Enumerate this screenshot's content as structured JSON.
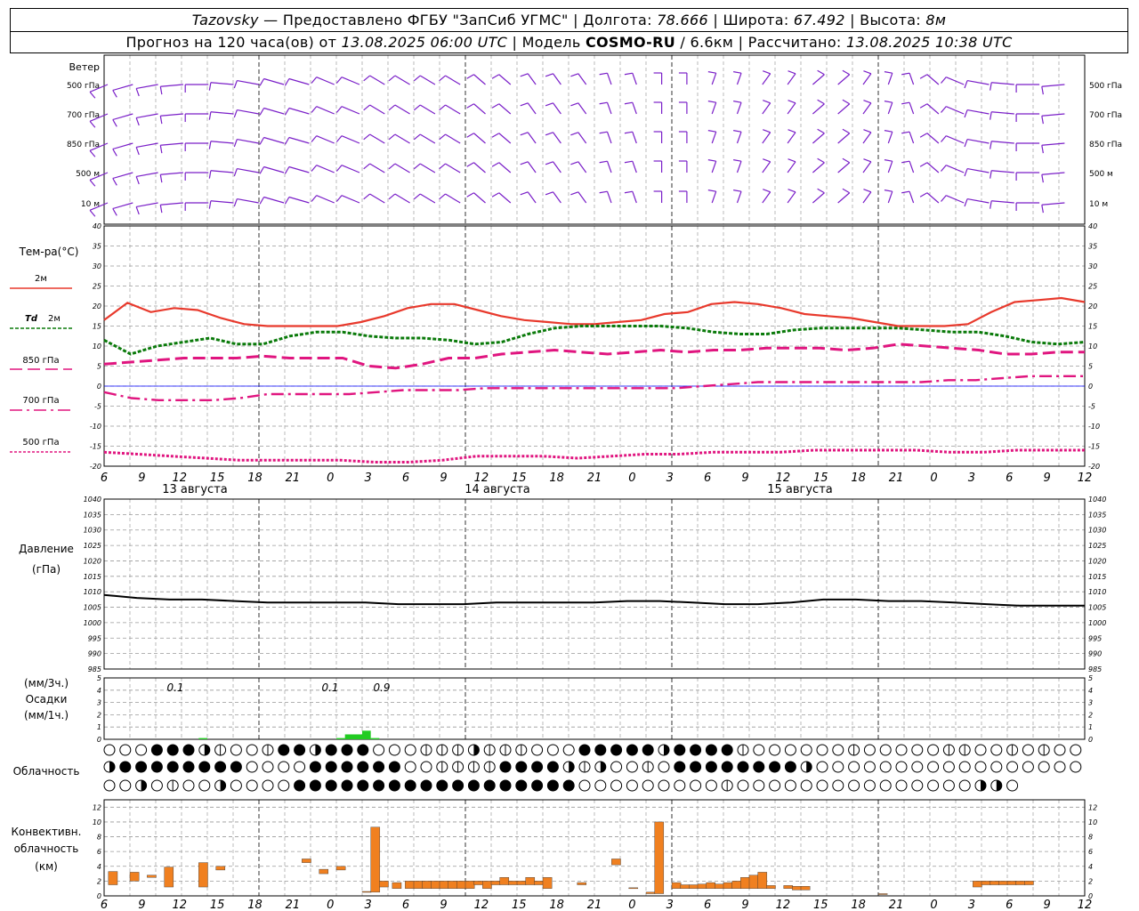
{
  "header": {
    "station": "Tazovsky",
    "provider": "— Предоставлено ФГБУ \"ЗапСиб УГМС\"",
    "lon_label": "| Долгота:",
    "lon": "78.666",
    "lat_label": "| Широта:",
    "lat": "67.492",
    "alt_label": "| Высота:",
    "alt": "8м",
    "fc_label": "Прогноз на 120 часа(ов) от",
    "fc_from": "13.08.2025 06:00 UTC",
    "model_label": "| Модель",
    "model": "COSMO-RU",
    "model_res": "/ 6.6км",
    "calc_label": "| Рассчитано:",
    "calc": "13.08.2025 10:38 UTC"
  },
  "labels": {
    "wind": "Ветер",
    "wind_levels": [
      "500 гПа",
      "700 гПа",
      "850 гПа",
      "500 м",
      "10 м"
    ],
    "temp": "Тем-ра(°C)",
    "t2m": "2м",
    "td_a": "Td",
    "td_b": "2м",
    "t850": "850 гПа",
    "t700": "700 гПа",
    "t500": "500 гПа",
    "pressure_a": "Давление",
    "pressure_b": "(гПа)",
    "precip_a": "(мм/3ч.)",
    "precip_b": "Осадки",
    "precip_c": "(мм/1ч.)",
    "cloud": "Облачность",
    "conv_a": "Конвективн.",
    "conv_b": "облачность",
    "conv_c": "(км)",
    "dates": [
      "13 августа",
      "14 августа",
      "15 августа"
    ]
  },
  "colors": {
    "wind": "#7a1fc8",
    "t2m": "#e8392c",
    "td": "#0a7a0a",
    "t850": "#e0157f",
    "t700": "#e0157f",
    "t500": "#e0157f",
    "precip": "#22cc22",
    "conv": "#f08020",
    "pressure": "#000000",
    "zero_line": "#0000ff"
  },
  "chart_data": [
    {
      "type": "line",
      "title": "Тем-ра(°C)",
      "x_hours": [
        0,
        3,
        6,
        9,
        12,
        15,
        18,
        21,
        24,
        27,
        30,
        33,
        36,
        39,
        42,
        45,
        48,
        51,
        54,
        57,
        60,
        63,
        66,
        69,
        72,
        75,
        78,
        81,
        84,
        87,
        90,
        93,
        96,
        99,
        102,
        105,
        108,
        111,
        114,
        117,
        120
      ],
      "x_tick_labels": [
        "6",
        "9",
        "12",
        "15",
        "18",
        "21",
        "0",
        "3",
        "6",
        "9",
        "12",
        "15",
        "18",
        "21",
        "0",
        "3",
        "6",
        "9",
        "12",
        "15",
        "18",
        "21",
        "0",
        "3",
        "6",
        "9",
        "12"
      ],
      "ylim": [
        -20,
        40
      ],
      "yticks": [
        -20,
        -15,
        -10,
        -5,
        0,
        5,
        10,
        15,
        20,
        25,
        30,
        35,
        40
      ],
      "series": [
        {
          "name": "2м",
          "key": "t2m",
          "values": [
            16.5,
            20.8,
            18.5,
            19.5,
            19,
            17,
            15.5,
            15,
            15,
            15,
            15,
            16,
            17.5,
            19.5,
            20.5,
            20.5,
            19,
            17.5,
            16.5,
            16,
            15.5,
            15.5,
            16,
            16.5,
            18,
            18.5,
            20.5,
            21,
            20.5,
            19.5,
            18,
            17.5,
            17,
            16,
            15,
            15,
            15,
            15.5,
            18.5,
            21,
            21.5,
            22,
            21
          ]
        },
        {
          "name": "Td 2м",
          "key": "td",
          "values": [
            11.5,
            8,
            10,
            11,
            12,
            10.5,
            10.5,
            12.5,
            13.5,
            13.5,
            12.5,
            12,
            12,
            11.5,
            10.5,
            11,
            13,
            14.5,
            15,
            15,
            15,
            15,
            14.5,
            13.5,
            13,
            13,
            14,
            14.5,
            14.5,
            14.5,
            14.5,
            14,
            13.5,
            13.5,
            12.5,
            11,
            10.5,
            11
          ]
        },
        {
          "name": "850 гПа",
          "key": "t850",
          "values": [
            5.5,
            6,
            6.5,
            7,
            7,
            7,
            7.5,
            7,
            7,
            7,
            5,
            4.5,
            5.5,
            7,
            7,
            8,
            8.5,
            9,
            8.5,
            8,
            8.5,
            9,
            8.5,
            9,
            9,
            9.5,
            9.5,
            9.5,
            9,
            9.5,
            10.5,
            10,
            9.5,
            9,
            8,
            8,
            8.5,
            8.5
          ]
        },
        {
          "name": "700 гПа",
          "key": "t700",
          "values": [
            -1.5,
            -3,
            -3.5,
            -3.5,
            -3.5,
            -3,
            -2,
            -2,
            -2,
            -2,
            -1.5,
            -1,
            -1,
            -1,
            -0.5,
            -0.5,
            -0.5,
            -0.5,
            -0.5,
            -0.5,
            -0.5,
            -0.5,
            0,
            0.5,
            1,
            1,
            1,
            1,
            1,
            1,
            1,
            1.5,
            1.5,
            2,
            2.5,
            2.5,
            2.5
          ]
        },
        {
          "name": "500 гПа",
          "key": "t500",
          "values": [
            -16.5,
            -17,
            -17.5,
            -18,
            -18.5,
            -18.5,
            -18.5,
            -18.5,
            -19,
            -19,
            -18.5,
            -17.5,
            -17.5,
            -17.5,
            -18,
            -17.5,
            -17,
            -17,
            -16.5,
            -16.5,
            -16.5,
            -16,
            -16,
            -16,
            -16,
            -16.5,
            -16.5,
            -16,
            -16,
            -16
          ]
        }
      ]
    },
    {
      "type": "line",
      "title": "Давление",
      "ylim": [
        985,
        1040
      ],
      "yticks": [
        985,
        990,
        995,
        1000,
        1005,
        1010,
        1015,
        1020,
        1025,
        1030,
        1035,
        1040
      ],
      "series": [
        {
          "name": "Давление",
          "values": [
            1009,
            1008,
            1007.5,
            1007.5,
            1007,
            1006.5,
            1006.5,
            1006.5,
            1006.5,
            1006,
            1006,
            1006,
            1006.5,
            1006.5,
            1006.5,
            1006.5,
            1007,
            1007,
            1006.5,
            1006,
            1006,
            1006.5,
            1007.5,
            1007.5,
            1007,
            1007,
            1006.5,
            1006,
            1005.5,
            1005.5,
            1005.5
          ]
        }
      ]
    },
    {
      "type": "bar",
      "title": "Осадки",
      "ylim": [
        0,
        5
      ],
      "yticks": [
        0,
        1,
        2,
        3,
        4,
        5
      ],
      "annotations": [
        {
          "hour": 6,
          "text": "0.1"
        },
        {
          "hour": 24,
          "text": "0.1"
        },
        {
          "hour": 30,
          "text": "0.9"
        }
      ],
      "bars": [
        {
          "start": 11,
          "end": 12,
          "value": 0.1
        },
        {
          "start": 27,
          "end": 28,
          "value": 0.1
        },
        {
          "start": 28,
          "end": 30,
          "value": 0.4
        },
        {
          "start": 30,
          "end": 31,
          "value": 0.7
        },
        {
          "start": 31,
          "end": 32,
          "value": 0.1
        }
      ]
    },
    {
      "type": "bar",
      "title": "Конвективн. облачность (км)",
      "ylim": [
        0,
        13
      ],
      "yticks": [
        0,
        2,
        4,
        6,
        8,
        10,
        12
      ],
      "bars": [
        {
          "start": 0.5,
          "b": 1.5,
          "t": 3.3
        },
        {
          "start": 3,
          "b": 2.0,
          "t": 3.2
        },
        {
          "start": 5,
          "b": 2.5,
          "t": 2.8
        },
        {
          "start": 7,
          "b": 1.2,
          "t": 3.9
        },
        {
          "start": 11,
          "b": 1.2,
          "t": 4.5
        },
        {
          "start": 13,
          "b": 3.5,
          "t": 4.0
        },
        {
          "start": 23,
          "b": 4.5,
          "t": 5.0
        },
        {
          "start": 25,
          "b": 3.0,
          "t": 3.6
        },
        {
          "start": 27,
          "b": 3.5,
          "t": 4.0
        },
        {
          "start": 30,
          "b": 0.5,
          "t": 0.6
        },
        {
          "start": 31,
          "b": 0.5,
          "t": 9.3
        },
        {
          "start": 32,
          "b": 1.2,
          "t": 2.0
        },
        {
          "start": 33.5,
          "b": 1.0,
          "t": 1.8
        },
        {
          "start": 35,
          "b": 1.0,
          "t": 2.0
        },
        {
          "start": 36,
          "b": 1.0,
          "t": 2.0
        },
        {
          "start": 37,
          "b": 1.0,
          "t": 2.0
        },
        {
          "start": 38,
          "b": 1.0,
          "t": 2.0
        },
        {
          "start": 39,
          "b": 1.0,
          "t": 2.0
        },
        {
          "start": 40,
          "b": 1.0,
          "t": 2.0
        },
        {
          "start": 41,
          "b": 1.0,
          "t": 2.0
        },
        {
          "start": 42,
          "b": 1.0,
          "t": 2.0
        },
        {
          "start": 43,
          "b": 1.5,
          "t": 2.0
        },
        {
          "start": 44,
          "b": 1.0,
          "t": 2.0
        },
        {
          "start": 45,
          "b": 1.5,
          "t": 2.0
        },
        {
          "start": 46,
          "b": 1.5,
          "t": 2.5
        },
        {
          "start": 47,
          "b": 1.5,
          "t": 2.0
        },
        {
          "start": 48,
          "b": 1.5,
          "t": 2.0
        },
        {
          "start": 49,
          "b": 1.5,
          "t": 2.5
        },
        {
          "start": 50,
          "b": 1.5,
          "t": 2.0
        },
        {
          "start": 51,
          "b": 1.0,
          "t": 2.5
        },
        {
          "start": 55,
          "b": 1.5,
          "t": 1.8
        },
        {
          "start": 59,
          "b": 4.2,
          "t": 5.0
        },
        {
          "start": 61,
          "b": 1.0,
          "t": 1.1
        },
        {
          "start": 63,
          "b": 0.3,
          "t": 0.5
        },
        {
          "start": 64,
          "b": 0.3,
          "t": 10.0
        },
        {
          "start": 66,
          "b": 1.0,
          "t": 1.8
        },
        {
          "start": 67,
          "b": 1.0,
          "t": 1.5
        },
        {
          "start": 68,
          "b": 1.0,
          "t": 1.5
        },
        {
          "start": 69,
          "b": 1.0,
          "t": 1.6
        },
        {
          "start": 70,
          "b": 1.0,
          "t": 1.8
        },
        {
          "start": 71,
          "b": 1.0,
          "t": 1.6
        },
        {
          "start": 72,
          "b": 1.0,
          "t": 1.8
        },
        {
          "start": 73,
          "b": 1.0,
          "t": 2.0
        },
        {
          "start": 74,
          "b": 1.0,
          "t": 2.5
        },
        {
          "start": 75,
          "b": 1.0,
          "t": 2.8
        },
        {
          "start": 76,
          "b": 1.0,
          "t": 3.2
        },
        {
          "start": 77,
          "b": 1.0,
          "t": 1.4
        },
        {
          "start": 79,
          "b": 1.0,
          "t": 1.4
        },
        {
          "start": 80,
          "b": 0.8,
          "t": 1.3
        },
        {
          "start": 81,
          "b": 0.8,
          "t": 1.3
        },
        {
          "start": 90,
          "b": 0.2,
          "t": 0.3
        },
        {
          "start": 101,
          "b": 1.2,
          "t": 2.0
        },
        {
          "start": 102,
          "b": 1.5,
          "t": 2.0
        },
        {
          "start": 103,
          "b": 1.5,
          "t": 2.0
        },
        {
          "start": 104,
          "b": 1.5,
          "t": 2.0
        },
        {
          "start": 105,
          "b": 1.5,
          "t": 2.0
        },
        {
          "start": 106,
          "b": 1.5,
          "t": 2.0
        },
        {
          "start": 107,
          "b": 1.5,
          "t": 2.0
        }
      ]
    }
  ],
  "wind_direction_rows": [
    [
      230,
      240,
      250,
      260,
      270,
      280,
      290,
      300,
      300,
      310,
      310,
      320,
      320,
      320,
      320,
      330,
      330,
      340,
      340,
      340,
      350,
      350,
      0,
      0,
      10,
      10,
      20,
      20,
      30,
      30,
      20,
      10,
      350,
      330,
      310,
      290,
      280,
      270,
      260
    ],
    [
      230,
      240,
      250,
      260,
      270,
      280,
      290,
      300,
      300,
      310,
      310,
      320,
      320,
      320,
      320,
      330,
      330,
      340,
      340,
      340,
      350,
      350,
      0,
      0,
      10,
      10,
      20,
      20,
      30,
      30,
      20,
      10,
      350,
      330,
      310,
      290,
      280,
      270,
      260
    ],
    [
      230,
      240,
      250,
      260,
      270,
      280,
      290,
      300,
      300,
      310,
      310,
      320,
      320,
      320,
      320,
      330,
      330,
      340,
      340,
      340,
      350,
      350,
      0,
      0,
      10,
      10,
      20,
      20,
      30,
      30,
      20,
      10,
      350,
      330,
      310,
      290,
      280,
      270,
      260
    ],
    [
      230,
      240,
      250,
      260,
      270,
      280,
      290,
      300,
      300,
      310,
      310,
      320,
      320,
      320,
      320,
      330,
      330,
      340,
      340,
      340,
      350,
      350,
      0,
      0,
      10,
      10,
      20,
      20,
      30,
      30,
      20,
      10,
      350,
      330,
      310,
      290,
      280,
      270,
      260
    ],
    [
      230,
      240,
      250,
      260,
      270,
      280,
      290,
      300,
      300,
      310,
      310,
      320,
      320,
      320,
      320,
      330,
      330,
      340,
      340,
      340,
      350,
      350,
      0,
      0,
      10,
      10,
      20,
      20,
      30,
      30,
      20,
      10,
      350,
      330,
      310,
      290,
      280,
      270,
      260
    ]
  ],
  "cloud_rows": [
    [
      0,
      0,
      0,
      4,
      4,
      4,
      2,
      1,
      0,
      0,
      1,
      4,
      4,
      2,
      4,
      4,
      4,
      0,
      0,
      0,
      1,
      1,
      1,
      2,
      1,
      1,
      1,
      0,
      0,
      0,
      4,
      4,
      4,
      4,
      4,
      2,
      4,
      4,
      4,
      4,
      1,
      0,
      0,
      0,
      0,
      0,
      0,
      1,
      0,
      0,
      0,
      0,
      0,
      1,
      1,
      0,
      0,
      1,
      0,
      1,
      0,
      0
    ],
    [
      2,
      4,
      4,
      4,
      4,
      4,
      4,
      4,
      4,
      0,
      0,
      0,
      0,
      4,
      4,
      4,
      4,
      4,
      4,
      0,
      0,
      1,
      1,
      1,
      1,
      4,
      4,
      4,
      4,
      2,
      1,
      2,
      0,
      0,
      1,
      0,
      4,
      4,
      4,
      4,
      4,
      4,
      4,
      4,
      2,
      0,
      0,
      0,
      0,
      0,
      0,
      0,
      0,
      0,
      0,
      0,
      0,
      0,
      0,
      0,
      0,
      0
    ],
    [
      0,
      0,
      2,
      0,
      1,
      0,
      0,
      2,
      0,
      0,
      0,
      0,
      4,
      4,
      4,
      4,
      4,
      4,
      4,
      4,
      4,
      4,
      4,
      4,
      4,
      4,
      4,
      4,
      4,
      4,
      0,
      0,
      0,
      0,
      0,
      0,
      0,
      0,
      0,
      1,
      0,
      0,
      0,
      0,
      0,
      0,
      0,
      0,
      0,
      0,
      0,
      0,
      0,
      0,
      0,
      2,
      2,
      0
    ]
  ]
}
